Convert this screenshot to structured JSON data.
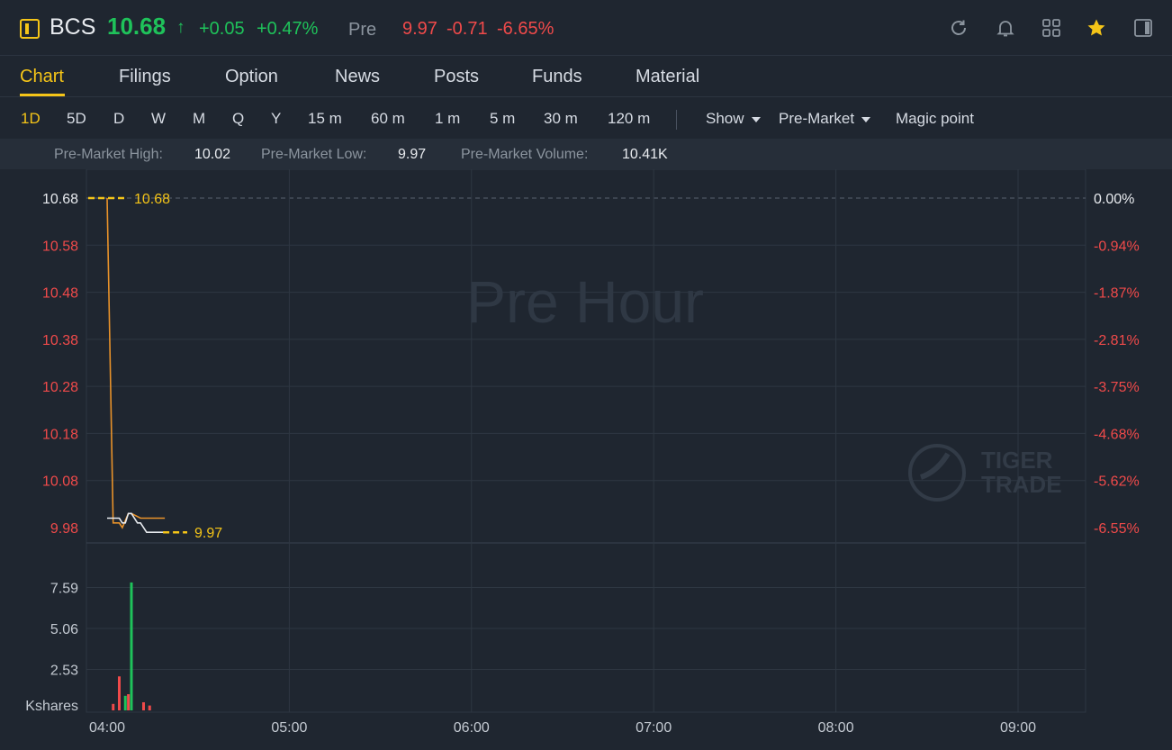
{
  "header": {
    "symbol": "BCS",
    "price": "10.68",
    "arrow": "↑",
    "change": "+0.05",
    "change_pct": "+0.47%",
    "pre_label": "Pre",
    "pre_price": "9.97",
    "pre_change": "-0.71",
    "pre_change_pct": "-6.65%",
    "icons": [
      "refresh-icon",
      "bell-icon",
      "grid-icon",
      "star-icon",
      "panel-icon"
    ]
  },
  "tabs": [
    {
      "label": "Chart",
      "active": true
    },
    {
      "label": "Filings"
    },
    {
      "label": "Option"
    },
    {
      "label": "News"
    },
    {
      "label": "Posts"
    },
    {
      "label": "Funds"
    },
    {
      "label": "Material"
    }
  ],
  "periods": [
    "1D",
    "5D",
    "D",
    "W",
    "M",
    "Q",
    "Y",
    "15 m",
    "60 m",
    "1 m",
    "5 m",
    "30 m",
    "120 m"
  ],
  "active_period": "1D",
  "dropdowns": {
    "show": "Show",
    "session": "Pre-Market",
    "magic": "Magic point"
  },
  "stats": {
    "high_label": "Pre-Market High:",
    "high": "10.02",
    "low_label": "Pre-Market Low:",
    "low": "9.97",
    "vol_label": "Pre-Market Volume:",
    "vol": "10.41K"
  },
  "chart_data": {
    "type": "line",
    "watermark": "Pre Hour",
    "brand_watermark": [
      "TIGER",
      "TRADE"
    ],
    "x_tick_labels": [
      "04:00",
      "05:00",
      "06:00",
      "07:00",
      "08:00",
      "09:00"
    ],
    "y_tick_labels": [
      "10.68",
      "10.58",
      "10.48",
      "10.38",
      "10.28",
      "10.18",
      "10.08",
      "9.98"
    ],
    "pct_tick_labels": [
      "0.00%",
      "-0.94%",
      "-1.87%",
      "-2.81%",
      "-3.75%",
      "-4.68%",
      "-5.62%",
      "-6.55%"
    ],
    "price_marker_high": "10.68",
    "price_marker_low": "9.97",
    "series": [
      {
        "x": [
          "04:00",
          "04:00",
          "04:02",
          "04:04",
          "04:05",
          "04:07",
          "04:08",
          "04:11",
          "04:12",
          "04:19"
        ],
        "values": [
          10.68,
          10.68,
          9.99,
          9.99,
          9.98,
          10.01,
          10.01,
          10.0,
          10.0,
          10.0
        ],
        "color": "#e8922a"
      },
      {
        "x": [
          "04:00",
          "04:02",
          "04:04",
          "04:05",
          "04:06",
          "04:07",
          "04:08",
          "04:10",
          "04:11",
          "04:13",
          "04:19"
        ],
        "values": [
          10.0,
          10.0,
          10.0,
          9.99,
          9.99,
          10.01,
          10.01,
          9.99,
          9.99,
          9.97,
          9.97
        ],
        "color": "#e8ebef"
      }
    ],
    "volume": {
      "unit_label": "Kshares",
      "tick_labels": [
        "7.59",
        "5.06",
        "2.53"
      ],
      "bars": [
        {
          "x": "04:02",
          "value": 0.4,
          "color": "#f04a4a"
        },
        {
          "x": "04:04",
          "value": 2.1,
          "color": "#f04a4a"
        },
        {
          "x": "04:06",
          "value": 0.9,
          "color": "#1fc25a"
        },
        {
          "x": "04:07",
          "value": 1.0,
          "color": "#f04a4a"
        },
        {
          "x": "04:08",
          "value": 7.9,
          "color": "#1fc25a"
        },
        {
          "x": "04:12",
          "value": 0.5,
          "color": "#f04a4a"
        },
        {
          "x": "04:14",
          "value": 0.3,
          "color": "#f04a4a"
        }
      ]
    }
  }
}
